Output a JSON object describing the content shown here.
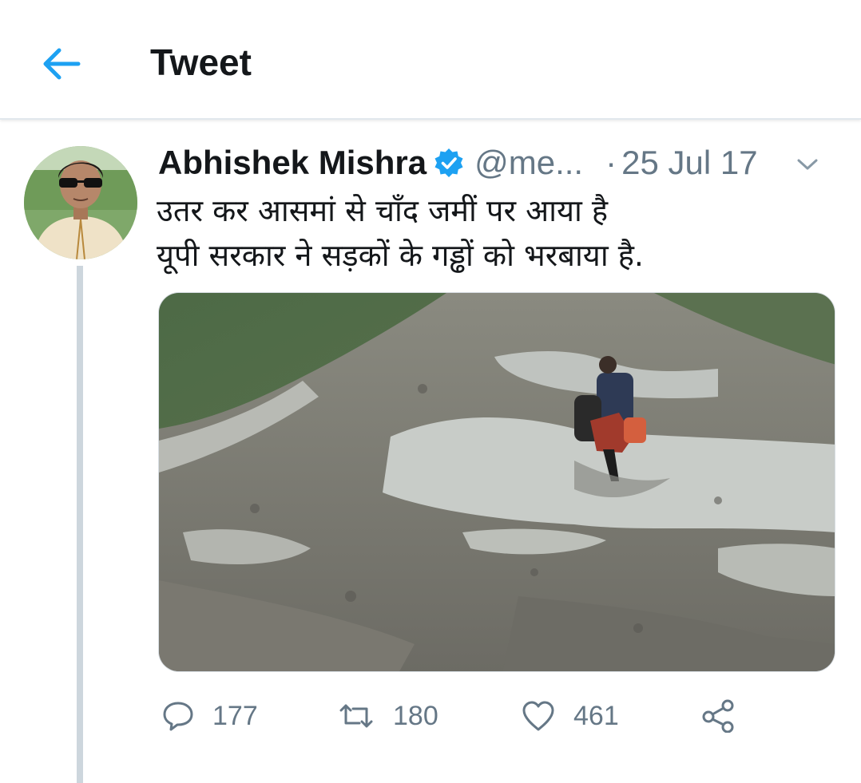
{
  "header": {
    "title": "Tweet",
    "back_icon": "arrow-left-icon",
    "accent_color": "#1da1f2"
  },
  "tweet": {
    "author": {
      "display_name": "Abhishek Mishra",
      "verified": true,
      "handle": "@me..."
    },
    "separator": "·",
    "date": "25 Jul 17",
    "text_lines": [
      "उतर कर आसमां से चाँद जमीं पर आया है",
      "यूपी सरकार ने सड़कों के गड्ढों को भरबाया है."
    ],
    "actions": {
      "replies": "177",
      "retweets": "180",
      "likes": "461"
    }
  }
}
